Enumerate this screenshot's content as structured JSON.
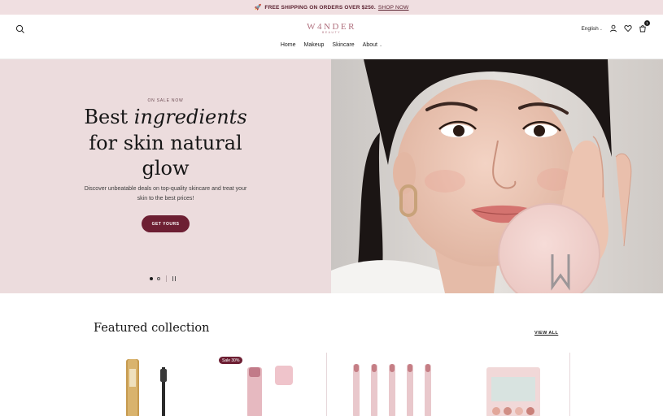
{
  "announcement": {
    "text": "FREE SHIPPING ON ORDERS OVER $250.",
    "link": "SHOP NOW"
  },
  "header": {
    "logo": "W4NDER",
    "logo_sub": "BEAUTY",
    "nav": [
      "Home",
      "Makeup",
      "Skincare",
      "About"
    ],
    "language": "English",
    "cart_count": "1"
  },
  "hero": {
    "eyebrow": "ON SALE NOW",
    "headline_lead": "Best ",
    "headline_emphasis": "ingredients",
    "headline_rest_1": "for skin natural",
    "headline_rest_2": "glow",
    "subcopy": "Discover unbeatable deals on top-quality skincare and treat your skin to the best prices!",
    "cta": "GET YOURS",
    "slides": 2,
    "active_slide": 1
  },
  "featured": {
    "title": "Featured collection",
    "view_all": "VIEW ALL",
    "badge": "Sale 30%"
  },
  "colors": {
    "accent": "#6d1f33",
    "hero_bg": "#ecdcdd",
    "announce_bg": "#f0dfe1"
  },
  "icons": [
    "search-icon",
    "account-icon",
    "wishlist-icon",
    "cart-icon",
    "rocket-icon",
    "chevron-down-icon",
    "pause-icon"
  ]
}
